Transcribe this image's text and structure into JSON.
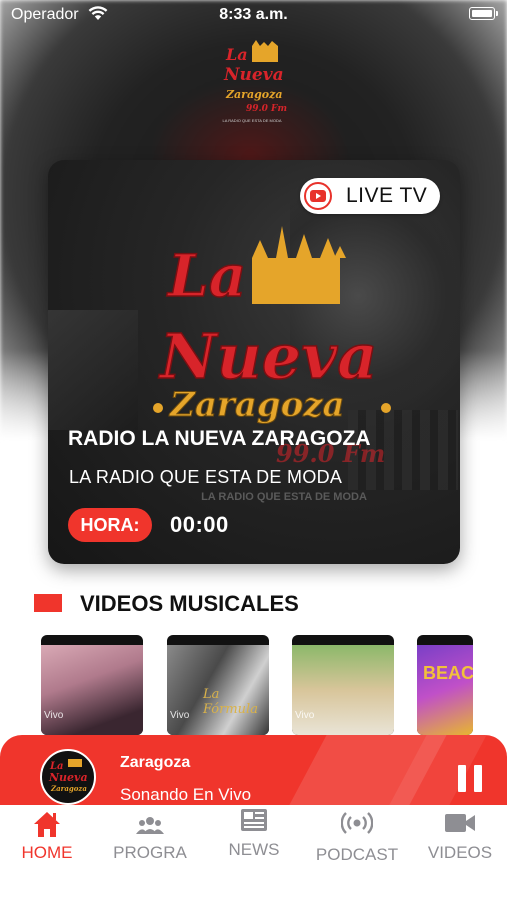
{
  "status_bar": {
    "carrier": "Operador",
    "time": "8:33 a.m."
  },
  "logo": {
    "line1": "La",
    "line2": "Nueva",
    "line3": "Zaragoza",
    "line4": "99.0 Fm",
    "tagline": "LA RADIO QUE ESTA DE MODA"
  },
  "hero": {
    "live_label": "LIVE TV",
    "station_title": "RADIO LA NUEVA ZARAGOZA",
    "station_subtitle": "LA RADIO QUE ESTA DE MODA",
    "hora_label": "HORA:",
    "hora_value": "00:00"
  },
  "videos_section": {
    "title": "VIDEOS MUSICALES",
    "thumbs": [
      {
        "badge": "Vivo"
      },
      {
        "badge": "Vivo",
        "caption": "La Fórmula"
      },
      {
        "badge": "Vivo"
      },
      {
        "caption": "BEAC"
      }
    ]
  },
  "player": {
    "name": "Zaragoza",
    "status": "Sonando En Vivo"
  },
  "tabs": [
    {
      "label": "HOME",
      "icon": "home-icon",
      "active": true
    },
    {
      "label": "PROGRA",
      "icon": "people-icon",
      "active": false
    },
    {
      "label": "NEWS",
      "icon": "newspaper-icon",
      "active": false
    },
    {
      "label": "PODCAST",
      "icon": "broadcast-icon",
      "active": false
    },
    {
      "label": "VIDEOS",
      "icon": "video-camera-icon",
      "active": false
    }
  ],
  "colors": {
    "accent": "#f0352c",
    "logo_red": "#d8242a",
    "logo_gold": "#e5a52a",
    "tab_inactive": "#8e8e93"
  }
}
